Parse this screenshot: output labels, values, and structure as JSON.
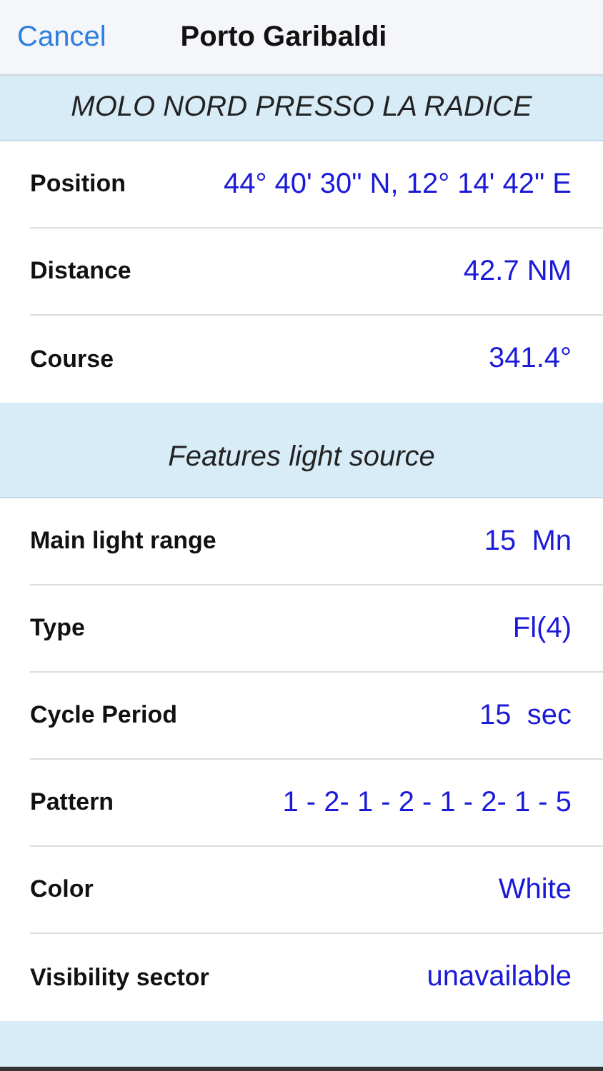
{
  "nav": {
    "cancel": "Cancel",
    "title": "Porto Garibaldi"
  },
  "sections": [
    {
      "header": "MOLO NORD PRESSO LA RADICE",
      "rows": [
        {
          "label": "Position",
          "value": "44° 40' 30\" N, 12° 14' 42\" E"
        },
        {
          "label": "Distance",
          "value": "42.7 NM"
        },
        {
          "label": "Course",
          "value": "341.4°"
        }
      ]
    },
    {
      "header": "Features light source",
      "rows": [
        {
          "label": "Main light range",
          "value": "15  Mn"
        },
        {
          "label": "Type",
          "value": "Fl(4)"
        },
        {
          "label": "Cycle Period",
          "value": "15  sec"
        },
        {
          "label": "Pattern",
          "value": "1 - 2- 1 - 2 - 1 - 2- 1 - 5"
        },
        {
          "label": "Color",
          "value": "White"
        },
        {
          "label": "Visibility sector",
          "value": "unavailable"
        }
      ]
    }
  ]
}
